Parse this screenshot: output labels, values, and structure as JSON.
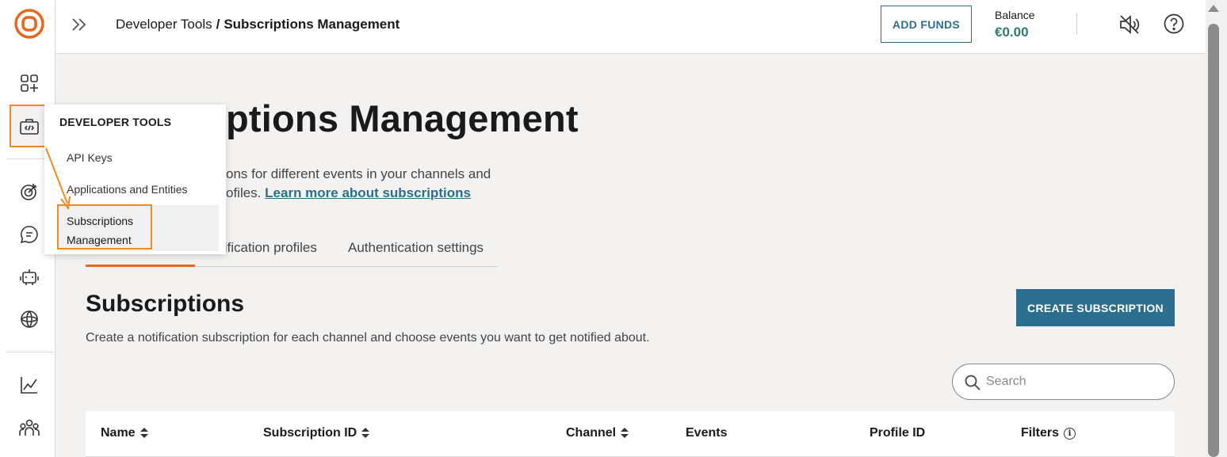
{
  "header": {
    "breadcrumb_parent": "Developer Tools",
    "breadcrumb_separator": "/",
    "breadcrumb_current": "Subscriptions Management",
    "add_funds_label": "ADD FUNDS",
    "balance_label": "Balance",
    "balance_value": "€0.00"
  },
  "main": {
    "title_visible": "ptions Management",
    "description_line1": "ons for different events in your channels and",
    "description_line2_prefix": "ofiles.",
    "learn_more_link": "Learn more about subscriptions",
    "tabs": [
      {
        "label": "tification profiles"
      },
      {
        "label": "Authentication settings"
      }
    ],
    "section_title": "Subscriptions",
    "section_description": "Create a notification subscription for each channel and choose events you want to get notified about.",
    "create_button_label": "CREATE SUBSCRIPTION",
    "search_placeholder": "Search",
    "table_columns": [
      "Name",
      "Subscription ID",
      "Channel",
      "Events",
      "Profile ID",
      "Filters"
    ]
  },
  "popover": {
    "heading": "DEVELOPER TOOLS",
    "items": [
      "API Keys",
      "Applications and Entities"
    ],
    "active_item_line1": "Subscriptions",
    "active_item_line2": "Management"
  },
  "colors": {
    "accent_orange": "#e8671e",
    "highlight_orange": "#f08a24",
    "primary_teal": "#2c6e8e",
    "balance_green": "#2f7a70"
  },
  "icons": {
    "rail": [
      "logo-icon",
      "apps-add-icon",
      "developer-tools-icon",
      "target-icon",
      "chat-icon",
      "bot-icon",
      "ai-icon",
      "analytics-icon",
      "people-icon"
    ],
    "header": [
      "double-chevron-right-icon",
      "mute-icon",
      "help-icon"
    ]
  }
}
